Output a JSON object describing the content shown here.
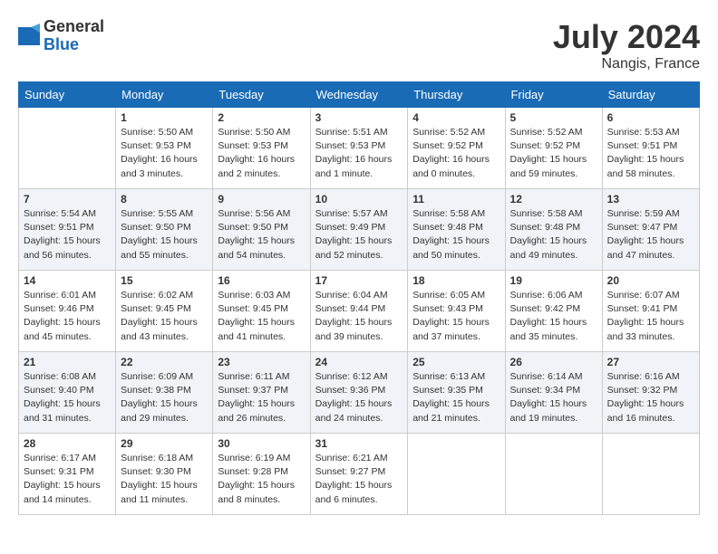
{
  "header": {
    "logo_general": "General",
    "logo_blue": "Blue",
    "month_title": "July 2024",
    "location": "Nangis, France"
  },
  "days_of_week": [
    "Sunday",
    "Monday",
    "Tuesday",
    "Wednesday",
    "Thursday",
    "Friday",
    "Saturday"
  ],
  "weeks": [
    [
      {
        "day": "",
        "info": ""
      },
      {
        "day": "1",
        "info": "Sunrise: 5:50 AM\nSunset: 9:53 PM\nDaylight: 16 hours\nand 3 minutes."
      },
      {
        "day": "2",
        "info": "Sunrise: 5:50 AM\nSunset: 9:53 PM\nDaylight: 16 hours\nand 2 minutes."
      },
      {
        "day": "3",
        "info": "Sunrise: 5:51 AM\nSunset: 9:53 PM\nDaylight: 16 hours\nand 1 minute."
      },
      {
        "day": "4",
        "info": "Sunrise: 5:52 AM\nSunset: 9:52 PM\nDaylight: 16 hours\nand 0 minutes."
      },
      {
        "day": "5",
        "info": "Sunrise: 5:52 AM\nSunset: 9:52 PM\nDaylight: 15 hours\nand 59 minutes."
      },
      {
        "day": "6",
        "info": "Sunrise: 5:53 AM\nSunset: 9:51 PM\nDaylight: 15 hours\nand 58 minutes."
      }
    ],
    [
      {
        "day": "7",
        "info": "Sunrise: 5:54 AM\nSunset: 9:51 PM\nDaylight: 15 hours\nand 56 minutes."
      },
      {
        "day": "8",
        "info": "Sunrise: 5:55 AM\nSunset: 9:50 PM\nDaylight: 15 hours\nand 55 minutes."
      },
      {
        "day": "9",
        "info": "Sunrise: 5:56 AM\nSunset: 9:50 PM\nDaylight: 15 hours\nand 54 minutes."
      },
      {
        "day": "10",
        "info": "Sunrise: 5:57 AM\nSunset: 9:49 PM\nDaylight: 15 hours\nand 52 minutes."
      },
      {
        "day": "11",
        "info": "Sunrise: 5:58 AM\nSunset: 9:48 PM\nDaylight: 15 hours\nand 50 minutes."
      },
      {
        "day": "12",
        "info": "Sunrise: 5:58 AM\nSunset: 9:48 PM\nDaylight: 15 hours\nand 49 minutes."
      },
      {
        "day": "13",
        "info": "Sunrise: 5:59 AM\nSunset: 9:47 PM\nDaylight: 15 hours\nand 47 minutes."
      }
    ],
    [
      {
        "day": "14",
        "info": "Sunrise: 6:01 AM\nSunset: 9:46 PM\nDaylight: 15 hours\nand 45 minutes."
      },
      {
        "day": "15",
        "info": "Sunrise: 6:02 AM\nSunset: 9:45 PM\nDaylight: 15 hours\nand 43 minutes."
      },
      {
        "day": "16",
        "info": "Sunrise: 6:03 AM\nSunset: 9:45 PM\nDaylight: 15 hours\nand 41 minutes."
      },
      {
        "day": "17",
        "info": "Sunrise: 6:04 AM\nSunset: 9:44 PM\nDaylight: 15 hours\nand 39 minutes."
      },
      {
        "day": "18",
        "info": "Sunrise: 6:05 AM\nSunset: 9:43 PM\nDaylight: 15 hours\nand 37 minutes."
      },
      {
        "day": "19",
        "info": "Sunrise: 6:06 AM\nSunset: 9:42 PM\nDaylight: 15 hours\nand 35 minutes."
      },
      {
        "day": "20",
        "info": "Sunrise: 6:07 AM\nSunset: 9:41 PM\nDaylight: 15 hours\nand 33 minutes."
      }
    ],
    [
      {
        "day": "21",
        "info": "Sunrise: 6:08 AM\nSunset: 9:40 PM\nDaylight: 15 hours\nand 31 minutes."
      },
      {
        "day": "22",
        "info": "Sunrise: 6:09 AM\nSunset: 9:38 PM\nDaylight: 15 hours\nand 29 minutes."
      },
      {
        "day": "23",
        "info": "Sunrise: 6:11 AM\nSunset: 9:37 PM\nDaylight: 15 hours\nand 26 minutes."
      },
      {
        "day": "24",
        "info": "Sunrise: 6:12 AM\nSunset: 9:36 PM\nDaylight: 15 hours\nand 24 minutes."
      },
      {
        "day": "25",
        "info": "Sunrise: 6:13 AM\nSunset: 9:35 PM\nDaylight: 15 hours\nand 21 minutes."
      },
      {
        "day": "26",
        "info": "Sunrise: 6:14 AM\nSunset: 9:34 PM\nDaylight: 15 hours\nand 19 minutes."
      },
      {
        "day": "27",
        "info": "Sunrise: 6:16 AM\nSunset: 9:32 PM\nDaylight: 15 hours\nand 16 minutes."
      }
    ],
    [
      {
        "day": "28",
        "info": "Sunrise: 6:17 AM\nSunset: 9:31 PM\nDaylight: 15 hours\nand 14 minutes."
      },
      {
        "day": "29",
        "info": "Sunrise: 6:18 AM\nSunset: 9:30 PM\nDaylight: 15 hours\nand 11 minutes."
      },
      {
        "day": "30",
        "info": "Sunrise: 6:19 AM\nSunset: 9:28 PM\nDaylight: 15 hours\nand 8 minutes."
      },
      {
        "day": "31",
        "info": "Sunrise: 6:21 AM\nSunset: 9:27 PM\nDaylight: 15 hours\nand 6 minutes."
      },
      {
        "day": "",
        "info": ""
      },
      {
        "day": "",
        "info": ""
      },
      {
        "day": "",
        "info": ""
      }
    ]
  ]
}
